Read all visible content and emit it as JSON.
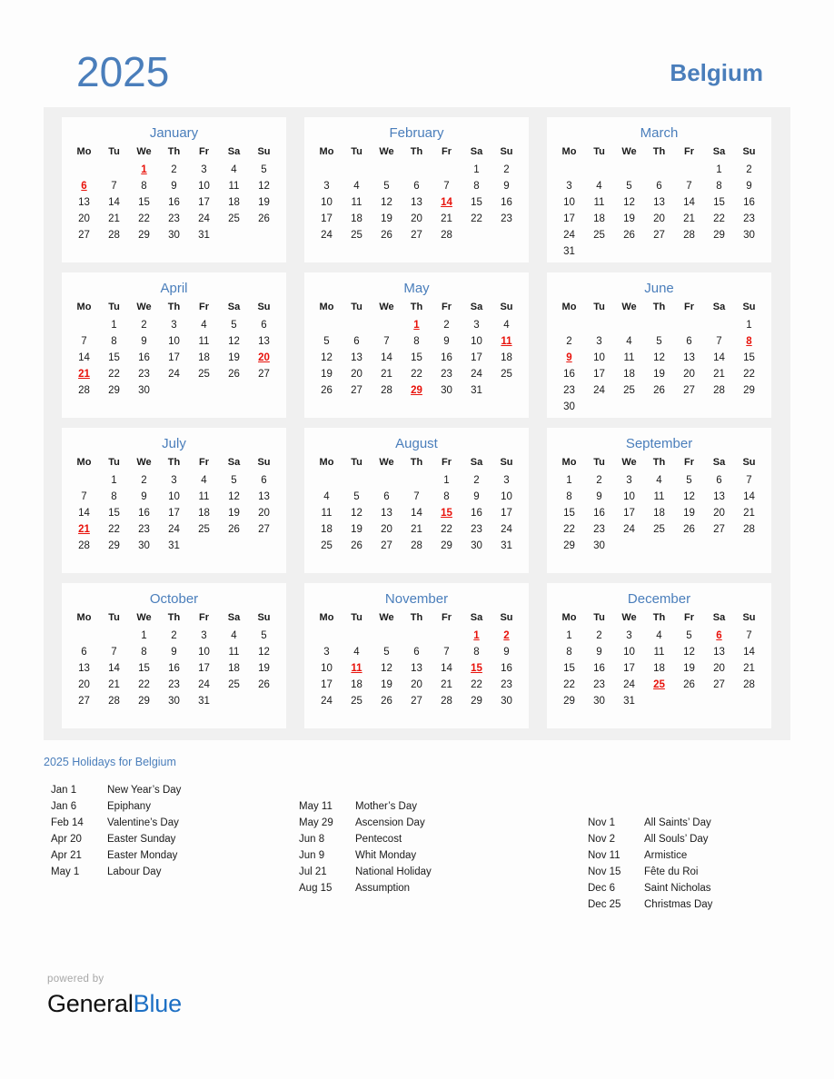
{
  "header": {
    "year": "2025",
    "country": "Belgium"
  },
  "colors": {
    "accent_blue": "#4a7ebb",
    "holiday_red": "#e8120b",
    "panel_gray": "#f0f0f0",
    "brand_blue": "#1c6fc4"
  },
  "weekday_headers": [
    "Mo",
    "Tu",
    "We",
    "Th",
    "Fr",
    "Sa",
    "Su"
  ],
  "months": [
    {
      "name": "January",
      "weeks": [
        [
          "",
          "",
          "1",
          "2",
          "3",
          "4",
          "5"
        ],
        [
          "6",
          "7",
          "8",
          "9",
          "10",
          "11",
          "12"
        ],
        [
          "13",
          "14",
          "15",
          "16",
          "17",
          "18",
          "19"
        ],
        [
          "20",
          "21",
          "22",
          "23",
          "24",
          "25",
          "26"
        ],
        [
          "27",
          "28",
          "29",
          "30",
          "31",
          "",
          ""
        ],
        [
          "",
          "",
          "",
          "",
          "",
          "",
          ""
        ]
      ],
      "holidays": [
        1,
        6
      ]
    },
    {
      "name": "February",
      "weeks": [
        [
          "",
          "",
          "",
          "",
          "",
          "1",
          "2"
        ],
        [
          "3",
          "4",
          "5",
          "6",
          "7",
          "8",
          "9"
        ],
        [
          "10",
          "11",
          "12",
          "13",
          "14",
          "15",
          "16"
        ],
        [
          "17",
          "18",
          "19",
          "20",
          "21",
          "22",
          "23"
        ],
        [
          "24",
          "25",
          "26",
          "27",
          "28",
          "",
          ""
        ],
        [
          "",
          "",
          "",
          "",
          "",
          "",
          ""
        ]
      ],
      "holidays": [
        14
      ]
    },
    {
      "name": "March",
      "weeks": [
        [
          "",
          "",
          "",
          "",
          "",
          "1",
          "2"
        ],
        [
          "3",
          "4",
          "5",
          "6",
          "7",
          "8",
          "9"
        ],
        [
          "10",
          "11",
          "12",
          "13",
          "14",
          "15",
          "16"
        ],
        [
          "17",
          "18",
          "19",
          "20",
          "21",
          "22",
          "23"
        ],
        [
          "24",
          "25",
          "26",
          "27",
          "28",
          "29",
          "30"
        ],
        [
          "31",
          "",
          "",
          "",
          "",
          "",
          ""
        ]
      ],
      "holidays": []
    },
    {
      "name": "April",
      "weeks": [
        [
          "",
          "1",
          "2",
          "3",
          "4",
          "5",
          "6"
        ],
        [
          "7",
          "8",
          "9",
          "10",
          "11",
          "12",
          "13"
        ],
        [
          "14",
          "15",
          "16",
          "17",
          "18",
          "19",
          "20"
        ],
        [
          "21",
          "22",
          "23",
          "24",
          "25",
          "26",
          "27"
        ],
        [
          "28",
          "29",
          "30",
          "",
          "",
          "",
          ""
        ],
        [
          "",
          "",
          "",
          "",
          "",
          "",
          ""
        ]
      ],
      "holidays": [
        20,
        21
      ]
    },
    {
      "name": "May",
      "weeks": [
        [
          "",
          "",
          "",
          "1",
          "2",
          "3",
          "4"
        ],
        [
          "5",
          "6",
          "7",
          "8",
          "9",
          "10",
          "11"
        ],
        [
          "12",
          "13",
          "14",
          "15",
          "16",
          "17",
          "18"
        ],
        [
          "19",
          "20",
          "21",
          "22",
          "23",
          "24",
          "25"
        ],
        [
          "26",
          "27",
          "28",
          "29",
          "30",
          "31",
          ""
        ],
        [
          "",
          "",
          "",
          "",
          "",
          "",
          ""
        ]
      ],
      "holidays": [
        1,
        11,
        29
      ]
    },
    {
      "name": "June",
      "weeks": [
        [
          "",
          "",
          "",
          "",
          "",
          "",
          "1"
        ],
        [
          "2",
          "3",
          "4",
          "5",
          "6",
          "7",
          "8"
        ],
        [
          "9",
          "10",
          "11",
          "12",
          "13",
          "14",
          "15"
        ],
        [
          "16",
          "17",
          "18",
          "19",
          "20",
          "21",
          "22"
        ],
        [
          "23",
          "24",
          "25",
          "26",
          "27",
          "28",
          "29"
        ],
        [
          "30",
          "",
          "",
          "",
          "",
          "",
          ""
        ]
      ],
      "holidays": [
        8,
        9
      ]
    },
    {
      "name": "July",
      "weeks": [
        [
          "",
          "1",
          "2",
          "3",
          "4",
          "5",
          "6"
        ],
        [
          "7",
          "8",
          "9",
          "10",
          "11",
          "12",
          "13"
        ],
        [
          "14",
          "15",
          "16",
          "17",
          "18",
          "19",
          "20"
        ],
        [
          "21",
          "22",
          "23",
          "24",
          "25",
          "26",
          "27"
        ],
        [
          "28",
          "29",
          "30",
          "31",
          "",
          "",
          ""
        ],
        [
          "",
          "",
          "",
          "",
          "",
          "",
          ""
        ]
      ],
      "holidays": [
        21
      ]
    },
    {
      "name": "August",
      "weeks": [
        [
          "",
          "",
          "",
          "",
          "1",
          "2",
          "3"
        ],
        [
          "4",
          "5",
          "6",
          "7",
          "8",
          "9",
          "10"
        ],
        [
          "11",
          "12",
          "13",
          "14",
          "15",
          "16",
          "17"
        ],
        [
          "18",
          "19",
          "20",
          "21",
          "22",
          "23",
          "24"
        ],
        [
          "25",
          "26",
          "27",
          "28",
          "29",
          "30",
          "31"
        ],
        [
          "",
          "",
          "",
          "",
          "",
          "",
          ""
        ]
      ],
      "holidays": [
        15
      ]
    },
    {
      "name": "September",
      "weeks": [
        [
          "1",
          "2",
          "3",
          "4",
          "5",
          "6",
          "7"
        ],
        [
          "8",
          "9",
          "10",
          "11",
          "12",
          "13",
          "14"
        ],
        [
          "15",
          "16",
          "17",
          "18",
          "19",
          "20",
          "21"
        ],
        [
          "22",
          "23",
          "24",
          "25",
          "26",
          "27",
          "28"
        ],
        [
          "29",
          "30",
          "",
          "",
          "",
          "",
          ""
        ],
        [
          "",
          "",
          "",
          "",
          "",
          "",
          ""
        ]
      ],
      "holidays": []
    },
    {
      "name": "October",
      "weeks": [
        [
          "",
          "",
          "1",
          "2",
          "3",
          "4",
          "5"
        ],
        [
          "6",
          "7",
          "8",
          "9",
          "10",
          "11",
          "12"
        ],
        [
          "13",
          "14",
          "15",
          "16",
          "17",
          "18",
          "19"
        ],
        [
          "20",
          "21",
          "22",
          "23",
          "24",
          "25",
          "26"
        ],
        [
          "27",
          "28",
          "29",
          "30",
          "31",
          "",
          ""
        ],
        [
          "",
          "",
          "",
          "",
          "",
          "",
          ""
        ]
      ],
      "holidays": []
    },
    {
      "name": "November",
      "weeks": [
        [
          "",
          "",
          "",
          "",
          "",
          "1",
          "2"
        ],
        [
          "3",
          "4",
          "5",
          "6",
          "7",
          "8",
          "9"
        ],
        [
          "10",
          "11",
          "12",
          "13",
          "14",
          "15",
          "16"
        ],
        [
          "17",
          "18",
          "19",
          "20",
          "21",
          "22",
          "23"
        ],
        [
          "24",
          "25",
          "26",
          "27",
          "28",
          "29",
          "30"
        ],
        [
          "",
          "",
          "",
          "",
          "",
          "",
          ""
        ]
      ],
      "holidays": [
        1,
        2,
        11,
        15
      ]
    },
    {
      "name": "December",
      "weeks": [
        [
          "1",
          "2",
          "3",
          "4",
          "5",
          "6",
          "7"
        ],
        [
          "8",
          "9",
          "10",
          "11",
          "12",
          "13",
          "14"
        ],
        [
          "15",
          "16",
          "17",
          "18",
          "19",
          "20",
          "21"
        ],
        [
          "22",
          "23",
          "24",
          "25",
          "26",
          "27",
          "28"
        ],
        [
          "29",
          "30",
          "31",
          "",
          "",
          "",
          ""
        ],
        [
          "",
          "",
          "",
          "",
          "",
          "",
          ""
        ]
      ],
      "holidays": [
        6,
        25
      ]
    }
  ],
  "holidays_section": {
    "title": "2025 Holidays for Belgium",
    "columns": [
      [
        {
          "date": "Jan 1",
          "name": "New Year’s Day"
        },
        {
          "date": "Jan 6",
          "name": "Epiphany"
        },
        {
          "date": "Feb 14",
          "name": "Valentine’s Day"
        },
        {
          "date": "Apr 20",
          "name": "Easter Sunday"
        },
        {
          "date": "Apr 21",
          "name": "Easter Monday"
        },
        {
          "date": "May 1",
          "name": "Labour Day"
        }
      ],
      [
        {
          "date": "May 11",
          "name": "Mother’s Day"
        },
        {
          "date": "May 29",
          "name": "Ascension Day"
        },
        {
          "date": "Jun 8",
          "name": "Pentecost"
        },
        {
          "date": "Jun 9",
          "name": "Whit Monday"
        },
        {
          "date": "Jul 21",
          "name": "National Holiday"
        },
        {
          "date": "Aug 15",
          "name": "Assumption"
        }
      ],
      [
        {
          "date": "Nov 1",
          "name": "All Saints’ Day"
        },
        {
          "date": "Nov 2",
          "name": "All Souls’ Day"
        },
        {
          "date": "Nov 11",
          "name": "Armistice"
        },
        {
          "date": "Nov 15",
          "name": "Fête du Roi"
        },
        {
          "date": "Dec 6",
          "name": "Saint Nicholas"
        },
        {
          "date": "Dec 25",
          "name": "Christmas Day"
        }
      ]
    ]
  },
  "footer": {
    "powered_by": "powered by",
    "brand_first": "General",
    "brand_second": "Blue"
  }
}
